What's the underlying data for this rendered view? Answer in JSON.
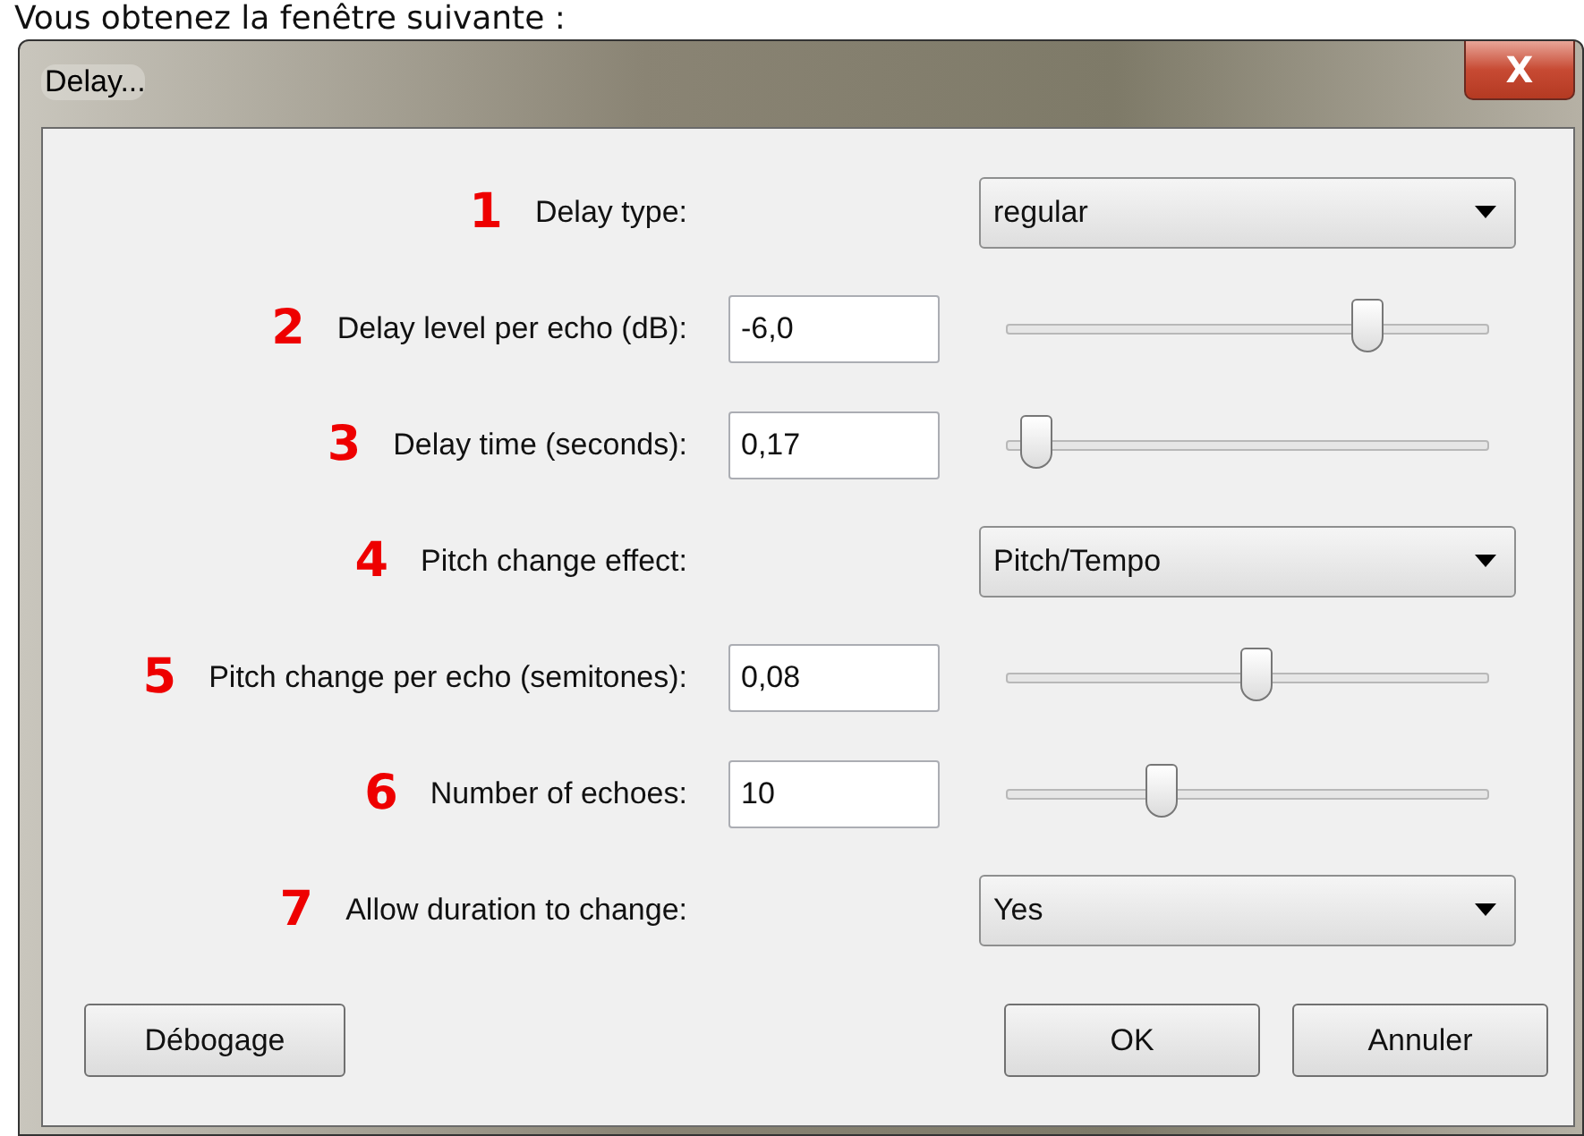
{
  "caption": "Vous obtenez la fenêtre suivante :",
  "window": {
    "title": "Delay...",
    "close": "X"
  },
  "rows": [
    {
      "number": "1",
      "label": "Delay type:",
      "kind": "choice",
      "value": "regular"
    },
    {
      "number": "2",
      "label": "Delay level per echo (dB):",
      "kind": "slider",
      "value": "-6,0",
      "level": 0.75
    },
    {
      "number": "3",
      "label": "Delay time (seconds):",
      "kind": "slider",
      "value": "0,17",
      "level": 0.06
    },
    {
      "number": "4",
      "label": "Pitch change effect:",
      "kind": "choice",
      "value": "Pitch/Tempo"
    },
    {
      "number": "5",
      "label": "Pitch change per echo (semitones):",
      "kind": "slider",
      "value": "0,08",
      "level": 0.52
    },
    {
      "number": "6",
      "label": "Number of echoes:",
      "kind": "slider",
      "value": "10",
      "level": 0.32
    },
    {
      "number": "7",
      "label": "Allow duration to change:",
      "kind": "choice",
      "value": "Yes"
    }
  ],
  "buttons": {
    "left": "Débogage",
    "right": [
      "OK",
      "Annuler"
    ]
  }
}
